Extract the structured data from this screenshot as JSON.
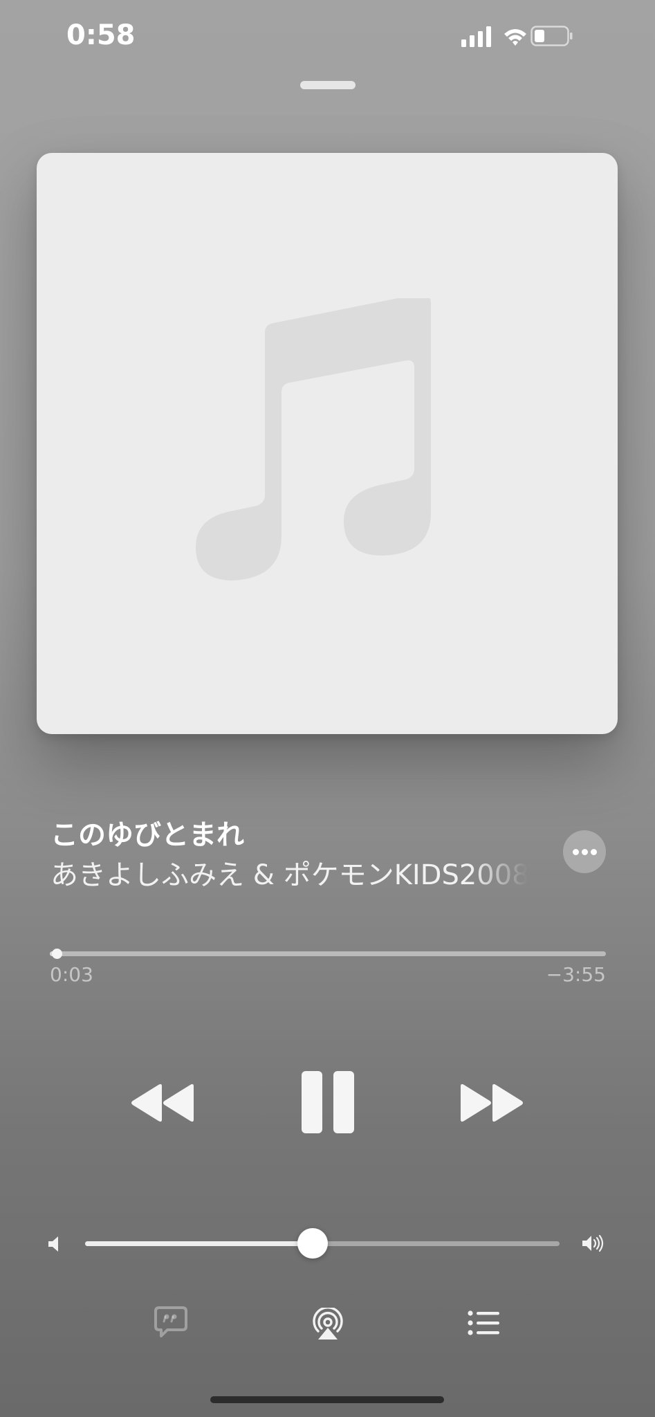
{
  "status_bar": {
    "time": "0:58",
    "signal_icon": "cellular-signal-icon",
    "wifi_icon": "wifi-icon",
    "battery_icon": "battery-low-icon"
  },
  "artwork": {
    "placeholder_icon": "music-note-icon"
  },
  "track": {
    "title": "このゆびとまれ",
    "artist": "あきよしふみえ & ポケモンKIDS2008"
  },
  "more_button": {
    "icon": "ellipsis-icon"
  },
  "playback": {
    "elapsed": "0:03",
    "remaining": "−3:55",
    "progress_fraction": 0.013
  },
  "controls": {
    "rewind_icon": "rewind-icon",
    "pause_icon": "pause-icon",
    "forward_icon": "fast-forward-icon"
  },
  "volume": {
    "level_fraction": 0.48,
    "min_icon": "speaker-low-icon",
    "max_icon": "speaker-high-icon"
  },
  "bottom_bar": {
    "lyrics_icon": "lyrics-quote-icon",
    "airplay_icon": "airplay-audio-icon",
    "queue_icon": "list-icon"
  },
  "colors": {
    "accent": "#ffffff",
    "artwork_bg": "#ececec",
    "note": "#dcdcdc"
  }
}
